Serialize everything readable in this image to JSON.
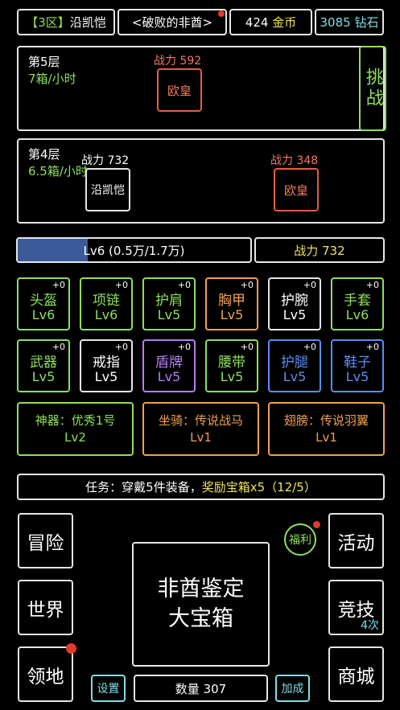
{
  "top": {
    "zone": "【3区】",
    "player": "沿凯恺",
    "guild": "<破败的非酋>",
    "gold_amount": "424",
    "gold_label": "金币",
    "diamond_amount": "3085",
    "diamond_label": "钻石"
  },
  "floor5": {
    "name": "第5层",
    "rate": "7箱/小时",
    "enemy_power": "战力 592",
    "enemy_name": "欧皇",
    "challenge": "挑战"
  },
  "floor4": {
    "name": "第4层",
    "rate": "6.5箱/小时",
    "self_power": "战力 732",
    "self_name": "沿凯恺",
    "enemy_power": "战力 348",
    "enemy_name": "欧皇"
  },
  "progress": {
    "label": "Lv6 (0.5万/1.7万)",
    "fraction": 0.3
  },
  "power": "战力 732",
  "equipment": [
    {
      "name": "头盔",
      "level": "Lv6",
      "plus": "+0",
      "color": "green"
    },
    {
      "name": "项链",
      "level": "Lv6",
      "plus": "+0",
      "color": "green"
    },
    {
      "name": "护肩",
      "level": "Lv5",
      "plus": "+0",
      "color": "green"
    },
    {
      "name": "胸甲",
      "level": "Lv5",
      "plus": "+0",
      "color": "orange"
    },
    {
      "name": "护腕",
      "level": "Lv5",
      "plus": "+0",
      "color": "white"
    },
    {
      "name": "手套",
      "level": "Lv6",
      "plus": "+0",
      "color": "green"
    },
    {
      "name": "武器",
      "level": "Lv5",
      "plus": "+0",
      "color": "green"
    },
    {
      "name": "戒指",
      "level": "Lv5",
      "plus": "+0",
      "color": "white"
    },
    {
      "name": "盾牌",
      "level": "Lv5",
      "plus": "+0",
      "color": "purple"
    },
    {
      "name": "腰带",
      "level": "Lv5",
      "plus": "+0",
      "color": "green"
    },
    {
      "name": "护腿",
      "level": "Lv5",
      "plus": "+0",
      "color": "blue"
    },
    {
      "name": "鞋子",
      "level": "Lv5",
      "plus": "+0",
      "color": "blue"
    }
  ],
  "extras": [
    {
      "name": "神器：优秀1号",
      "level": "Lv2",
      "color": "green"
    },
    {
      "name": "坐骑：传说战马",
      "level": "Lv1",
      "color": "orange"
    },
    {
      "name": "翅膀：传说羽翼",
      "level": "Lv1",
      "color": "orange"
    }
  ],
  "task": {
    "prefix": "任务：穿戴5件装备，",
    "reward": "奖励宝箱x5（12/5）"
  },
  "nav": {
    "adventure": "冒险",
    "world": "世界",
    "territory": "领地",
    "welfare": "福利",
    "activity": "活动",
    "arena": "竞技",
    "arena_count": "4次",
    "shop": "商城",
    "settings": "设置",
    "boost": "加成"
  },
  "chest": {
    "line1": "非酋鉴定",
    "line2": "大宝箱",
    "count": "数量 307"
  },
  "colors": {
    "green": "#8ee05a",
    "orange": "#f0a050",
    "purple": "#b57ef5",
    "blue": "#5a8ef5",
    "white": "#ffffff",
    "progress_fill": "#3a5a9a",
    "notify_dot": "#e23b2b"
  }
}
